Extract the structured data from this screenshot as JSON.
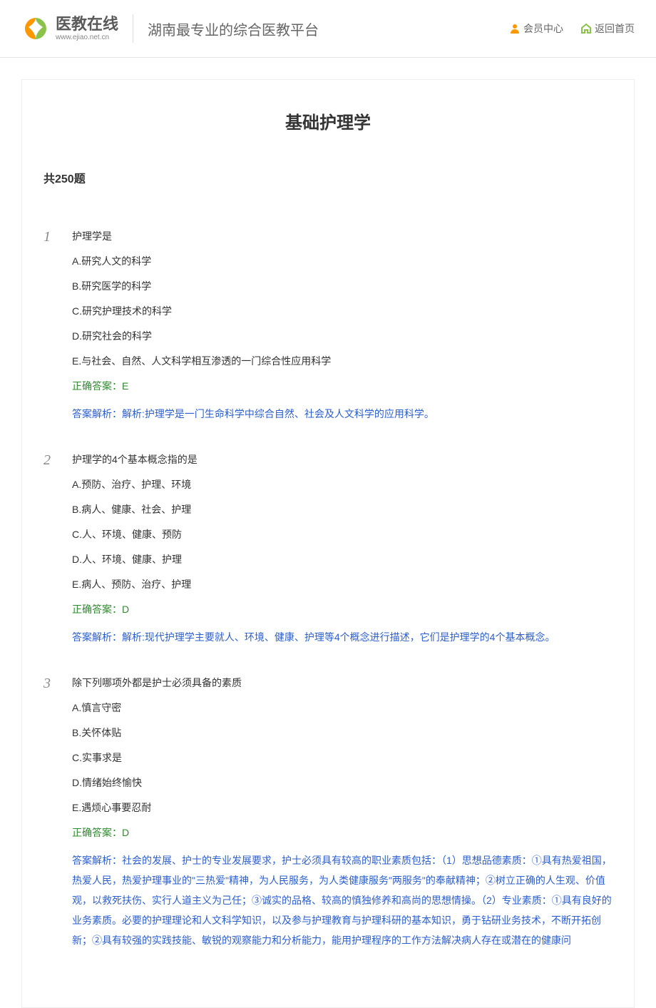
{
  "header": {
    "logo_text": "医教在线",
    "logo_url": "www.ejiao.net.cn",
    "slogan": "湖南最专业的综合医教平台",
    "member_center": "会员中心",
    "home_link": "返回首页"
  },
  "page": {
    "title": "基础护理学",
    "total": "共250题"
  },
  "questions": [
    {
      "num": "1",
      "text": "护理学是",
      "options": [
        "A.研究人文的科学",
        "B.研究医学的科学",
        "C.研究护理技术的科学",
        "D.研究社会的科学",
        "E.与社会、自然、人文科学相互渗透的一门综合性应用科学"
      ],
      "answer": "正确答案：E",
      "analysis": "答案解析：解析:护理学是一门生命科学中综合自然、社会及人文科学的应用科学。"
    },
    {
      "num": "2",
      "text": "护理学的4个基本概念指的是",
      "options": [
        "A.预防、治疗、护理、环境",
        "B.病人、健康、社会、护理",
        "C.人、环境、健康、预防",
        "D.人、环境、健康、护理",
        "E.病人、预防、治疗、护理"
      ],
      "answer": "正确答案：D",
      "analysis": "答案解析：解析:现代护理学主要就人、环境、健康、护理等4个概念进行描述，它们是护理学的4个基本概念。"
    },
    {
      "num": "3",
      "text": "除下列哪项外都是护士必须具备的素质",
      "options": [
        "A.慎言守密",
        "B.关怀体贴",
        "C.实事求是",
        "D.情绪始终愉快",
        "E.遇烦心事要忍耐"
      ],
      "answer": "正确答案：D",
      "analysis": "答案解析：社会的发展、护士的专业发展要求，护士必须具有较高的职业素质包括：（1）思想品德素质：①具有热爱祖国，热爱人民，热爱护理事业的\"三热爱\"精神，为人民服务，为人类健康服务\"两服务\"的奉献精神；②树立正确的人生观、价值观，以救死扶伤、实行人道主义为己任；③诚实的品格、较高的慎独修养和高尚的思想情操。（2）专业素质：①具有良好的业务素质。必要的护理理论和人文科学知识，以及参与护理教育与护理科研的基本知识，勇于钻研业务技术，不断开拓创新；②具有较强的实践技能、敏锐的观察能力和分析能力，能用护理程序的工作方法解决病人存在或潜在的健康问"
    }
  ]
}
